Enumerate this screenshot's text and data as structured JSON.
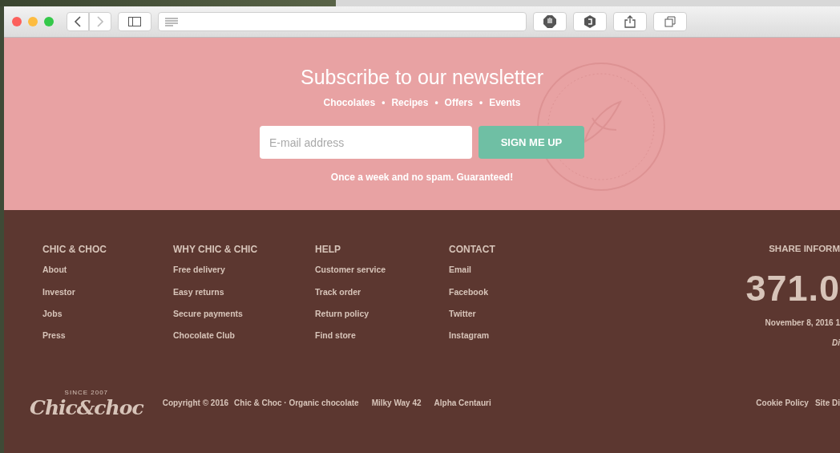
{
  "newsletter": {
    "title": "Subscribe to our newsletter",
    "topics": [
      "Chocolates",
      "Recipes",
      "Offers",
      "Events"
    ],
    "separator": "•",
    "email": {
      "placeholder": "E-mail address"
    },
    "button": "SIGN ME UP",
    "note": "Once a week and no spam. Guaranteed!"
  },
  "footer": {
    "columns": [
      {
        "heading": "CHIC & CHOC",
        "links": [
          "About",
          "Investor",
          "Jobs",
          "Press"
        ]
      },
      {
        "heading": "WHY CHIC & CHIC",
        "links": [
          "Free delivery",
          "Easy returns",
          "Secure payments",
          "Chocolate Club"
        ]
      },
      {
        "heading": "HELP",
        "links": [
          "Customer service",
          "Track order",
          "Return policy",
          "Find store"
        ]
      },
      {
        "heading": "CONTACT",
        "links": [
          "Email",
          "Facebook",
          "Twitter",
          "Instagram"
        ]
      }
    ],
    "share": {
      "heading": "SHARE INFORM",
      "price": "371.0",
      "date": "November 8, 2016 1",
      "note": "Di"
    },
    "logo": {
      "tagline": "SINCE 2007",
      "name": "Chic&choc"
    },
    "bottom": [
      "Copyright © 2016",
      "Chic & Choc · Organic chocolate",
      "Milky Way 42",
      "Alpha Centauri"
    ],
    "legal": [
      "Cookie Policy",
      "Site Di"
    ]
  }
}
